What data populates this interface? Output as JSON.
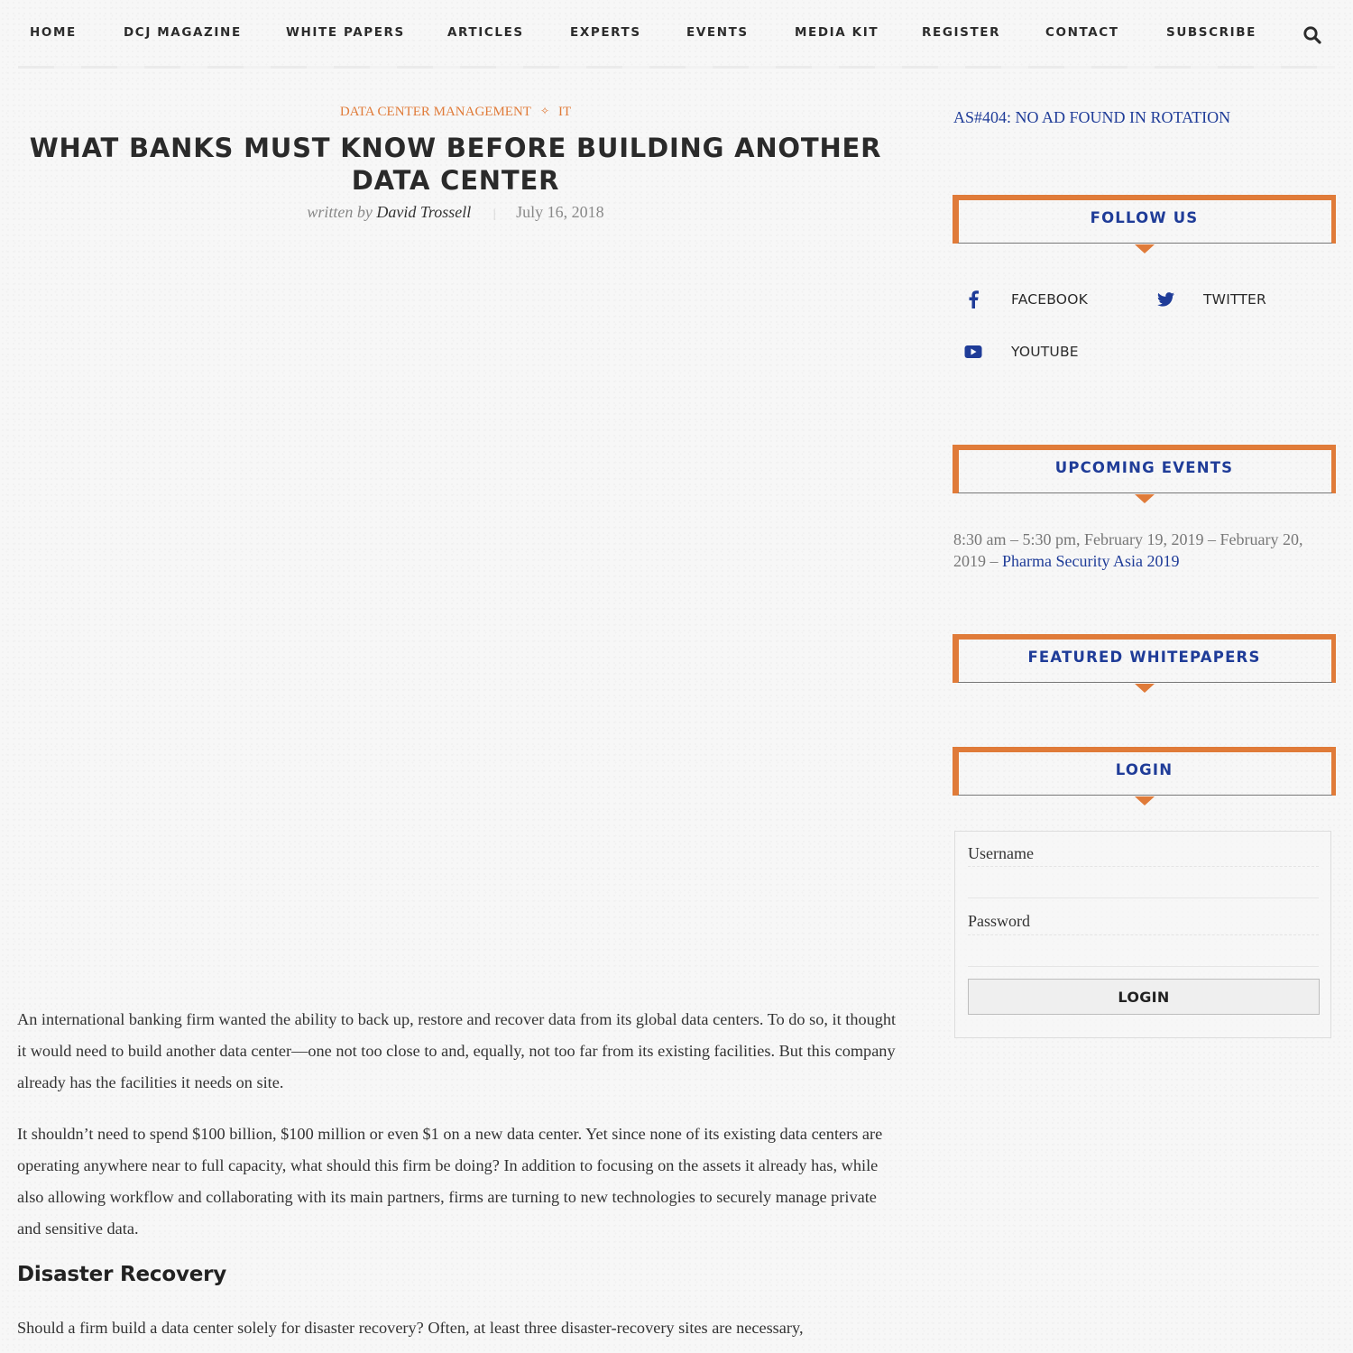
{
  "nav": {
    "items": [
      {
        "label": "HOME"
      },
      {
        "label": "DCJ MAGAZINE"
      },
      {
        "label": "WHITE PAPERS"
      },
      {
        "label": "ARTICLES"
      },
      {
        "label": "EXPERTS"
      },
      {
        "label": "EVENTS"
      },
      {
        "label": "MEDIA KIT"
      },
      {
        "label": "REGISTER"
      },
      {
        "label": "CONTACT"
      },
      {
        "label": "SUBSCRIBE"
      }
    ],
    "search_icon": "search-icon"
  },
  "article": {
    "categories": [
      {
        "label": "DATA CENTER MANAGEMENT"
      },
      {
        "label": "IT"
      }
    ],
    "category_separator": "✧",
    "title": "WHAT BANKS MUST KNOW BEFORE BUILDING ANOTHER DATA CENTER",
    "written_by": "written by",
    "author": "David Trossell",
    "meta_separator": "|",
    "date": "July 16, 2018",
    "paragraphs": [
      "An international banking firm wanted the ability to back up, restore and recover data from its global data centers. To do so, it thought it would need to build another data center—one not too close to and, equally, not too far from its existing facilities. But this company already has the facilities it needs on site.",
      "It shouldn’t need to spend $100 billion, $100 million or even $1 on a new data center. Yet since none of its existing data centers are operating anywhere near to full capacity, what should this firm be doing? In addition to focusing on the assets it already has, while also allowing workflow and collaborating with its main partners, firms are turning to new technologies to securely manage private and sensitive data."
    ],
    "subheading": "Disaster Recovery",
    "paragraph_after_subheading": "Should a firm build a data center solely for disaster recovery? Often, at least three disaster-recovery sites are necessary,"
  },
  "sidebar": {
    "ad_text": "AS#404: NO AD FOUND IN ROTATION",
    "follow": {
      "title": "FOLLOW US",
      "links": [
        {
          "label": "FACEBOOK",
          "icon": "facebook-icon"
        },
        {
          "label": "TWITTER",
          "icon": "twitter-icon"
        },
        {
          "label": "YOUTUBE",
          "icon": "youtube-icon"
        }
      ]
    },
    "events": {
      "title": "UPCOMING EVENTS",
      "items": [
        {
          "time": "8:30 am – 5:30 pm, February 19, 2019 – February 20, 2019 – ",
          "name": "Pharma Security Asia 2019"
        }
      ]
    },
    "whitepapers": {
      "title": "FEATURED WHITEPAPERS"
    },
    "login": {
      "title": "LOGIN",
      "username_label": "Username",
      "username_value": "",
      "password_label": "Password",
      "password_value": "",
      "button_label": "LOGIN"
    }
  },
  "colors": {
    "accent_orange": "#e07b39",
    "link_blue": "#1f3c98",
    "text_dark": "#2b2b2b",
    "background": "#f7f7f7"
  }
}
